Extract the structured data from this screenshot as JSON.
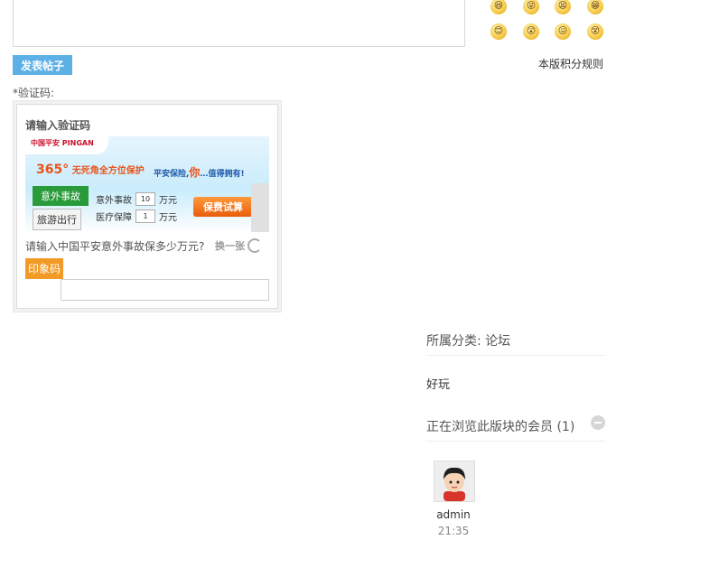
{
  "editor": {
    "emoji_icons": [
      "laugh-icon",
      "tongue-icon",
      "grin-icon",
      "teeth-icon",
      "smile-icon",
      "shock-icon",
      "cry-icon",
      "dizzy-icon"
    ]
  },
  "post_button_label": "发表帖子",
  "rules_link": "本版积分规则",
  "captcha": {
    "label": "*验证码:",
    "title": "请输入验证码",
    "ad": {
      "logo": "中国平安 PINGAN",
      "headline_num": "365°",
      "headline_text": "无死角全方位保护",
      "slogan_a": "平安保险,",
      "slogan_you": "你",
      "slogan_b": "…值得拥有!",
      "tab_accident": "意外事故",
      "tab_travel": "旅游出行",
      "row1_label": "意外事故",
      "row1_value": "10",
      "row2_label": "医疗保障",
      "row2_value": "1",
      "unit": "万元",
      "calc_button": "保费试算"
    },
    "question": "请输入中国平安意外事故保多少万元?",
    "refresh_label": "换一张",
    "seal_button": "印象码",
    "input_value": ""
  },
  "sidebar": {
    "category": "所属分类: 论坛",
    "description": "好玩",
    "browsing_title": "正在浏览此版块的会员 (1)",
    "member": {
      "name": "admin",
      "time": "21:35"
    }
  }
}
